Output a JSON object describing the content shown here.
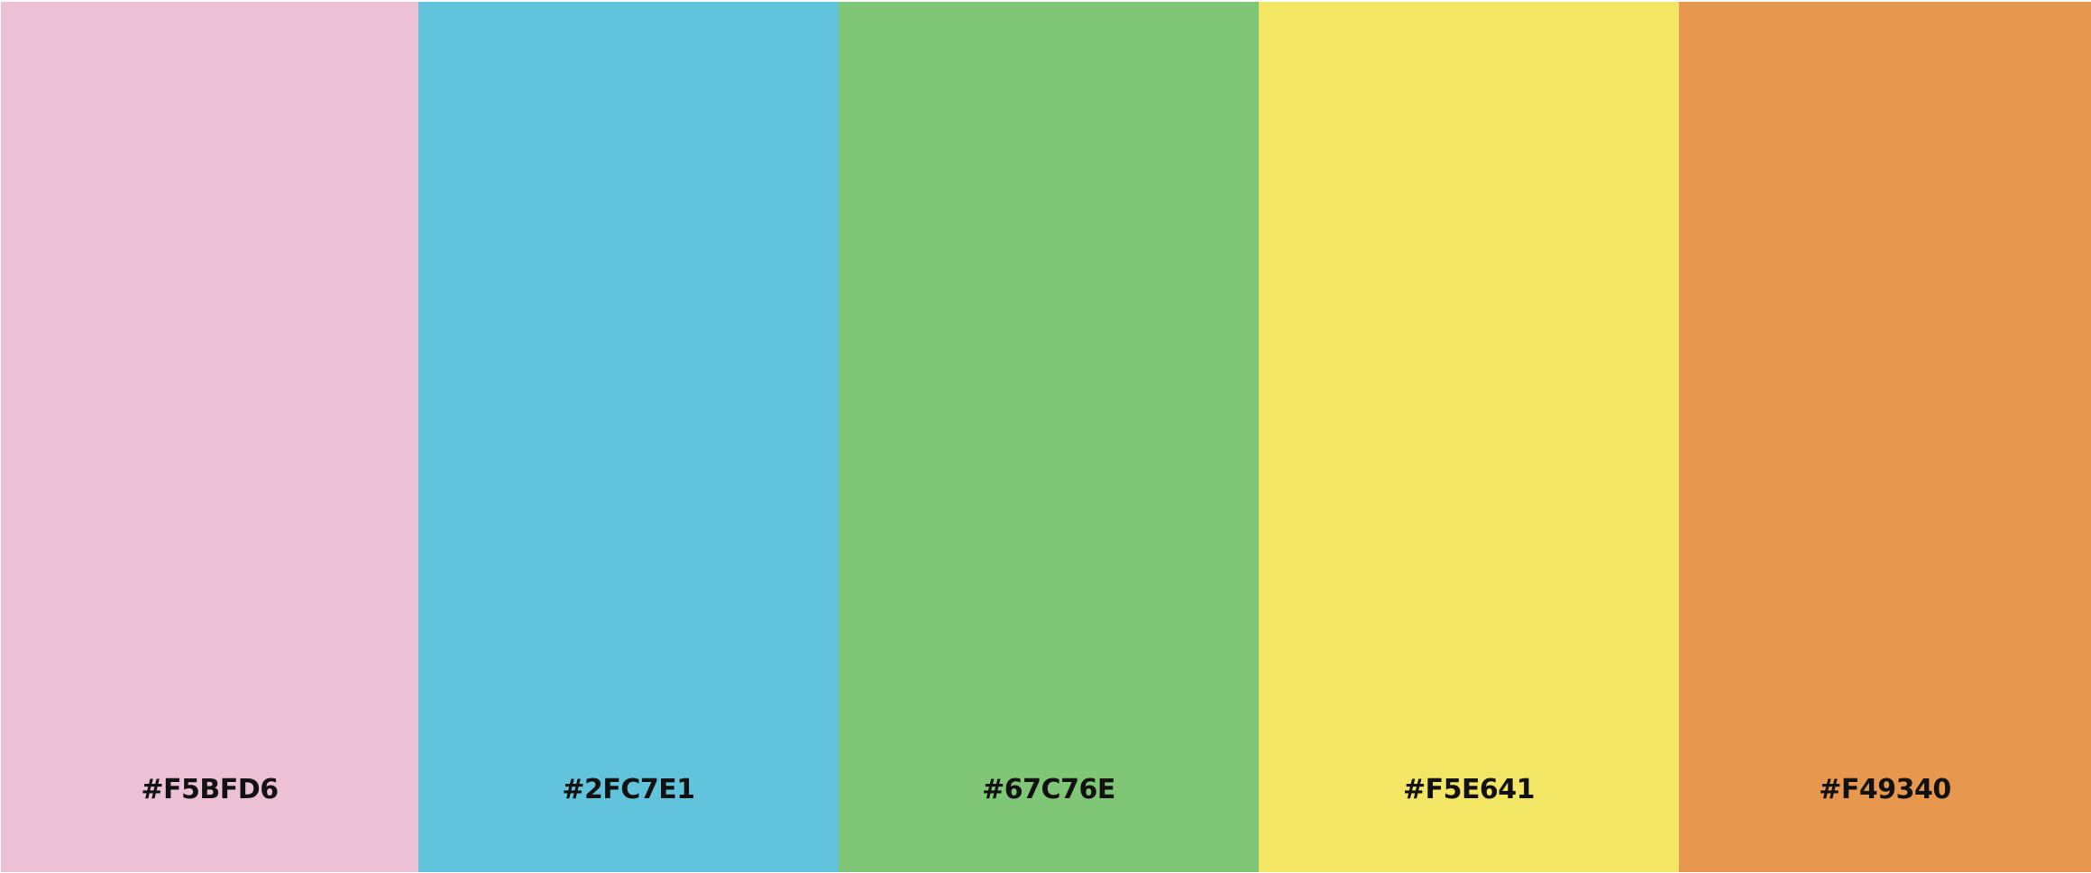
{
  "palette": {
    "swatches": [
      {
        "label": "#F5BFD6",
        "color": "#ECC1D6"
      },
      {
        "label": "#2FC7E1",
        "color": "#62C3DD"
      },
      {
        "label": "#67C76E",
        "color": "#7FC677"
      },
      {
        "label": "#F5E641",
        "color": "#F2E664"
      },
      {
        "label": "#F49340",
        "color": "#E8974F"
      }
    ]
  }
}
